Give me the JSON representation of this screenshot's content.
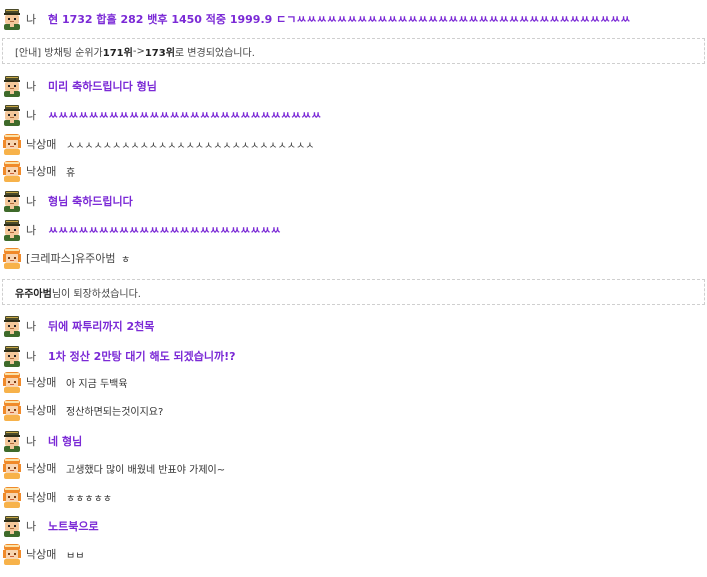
{
  "messages": [
    {
      "kind": "chat",
      "avatar": "male-soldier",
      "name": "나",
      "text": "현 1732 합홀 282 뱃후 1450 적중 1999.9 ㄷㄱㅆㅆㅆㅆㅆㅆㅆㅆㅆㅆㅆㅆㅆㅆㅆㅆㅆㅆㅆㅆㅆㅆㅆㅆㅆㅆㅆㅆㅆㅆㅆㅆㅆ"
    },
    {
      "kind": "notice",
      "parts": [
        {
          "text": "[안내] 방채팅 순위가 ",
          "bold": false
        },
        {
          "text": "171위",
          "bold": true
        },
        {
          "text": " -> ",
          "bold": false
        },
        {
          "text": "173위",
          "bold": true
        },
        {
          "text": " 로 변경되었습니다.",
          "bold": false
        }
      ]
    },
    {
      "kind": "chat",
      "avatar": "male-soldier",
      "name": "나",
      "text": "미리 축하드립니다 형님"
    },
    {
      "kind": "chat",
      "avatar": "male-soldier",
      "name": "나",
      "text": "ㅆㅆㅆㅆㅆㅆㅆㅆㅆㅆㅆㅆㅆㅆㅆㅆㅆㅆㅆㅆㅆㅆㅆㅆㅆㅆㅆ"
    },
    {
      "kind": "chat",
      "avatar": "female-orange",
      "name": "낙상매",
      "text": "ㅅㅅㅅㅅㅅㅅㅅㅅㅅㅅㅅㅅㅅㅅㅅㅅㅅㅅㅅㅅㅅㅅㅅㅅㅅㅅㅅ"
    },
    {
      "kind": "chat",
      "avatar": "female-orange",
      "name": "낙상매",
      "text": "휴"
    },
    {
      "kind": "chat",
      "avatar": "male-soldier",
      "name": "나",
      "text": "형님 축하드립니다"
    },
    {
      "kind": "chat",
      "avatar": "male-soldier",
      "name": "나",
      "text": "ㅆㅆㅆㅆㅆㅆㅆㅆㅆㅆㅆㅆㅆㅆㅆㅆㅆㅆㅆㅆㅆㅆㅆ"
    },
    {
      "kind": "chat",
      "avatar": "female-orange",
      "name": "[크레파스]유주아범",
      "text": "ㅎ"
    },
    {
      "kind": "notice",
      "parts": [
        {
          "text": "유주아범",
          "bold": true
        },
        {
          "text": "님이 퇴장하셨습니다.",
          "bold": false
        }
      ]
    },
    {
      "kind": "chat",
      "avatar": "male-soldier",
      "name": "나",
      "text": "뒤에 짜투리까지 2천목"
    },
    {
      "kind": "chat",
      "avatar": "male-soldier",
      "name": "나",
      "text": "1차 정산 2만탕 대기 해도 되겠습니까!?"
    },
    {
      "kind": "chat",
      "avatar": "female-orange",
      "name": "낙상매",
      "text": "아 지금 두백육"
    },
    {
      "kind": "chat",
      "avatar": "female-orange",
      "name": "낙상매",
      "text": "정산하면되는것이지요?"
    },
    {
      "kind": "chat",
      "avatar": "male-soldier",
      "name": "나",
      "text": "네 형님"
    },
    {
      "kind": "chat",
      "avatar": "female-orange",
      "name": "낙상매",
      "text": "고생했다 많이 배웠네 반표야 가제이~"
    },
    {
      "kind": "chat",
      "avatar": "female-orange",
      "name": "낙상매",
      "text": "ㅎㅎㅎㅎㅎ"
    },
    {
      "kind": "chat",
      "avatar": "male-soldier",
      "name": "나",
      "text": "노트북으로"
    },
    {
      "kind": "chat",
      "avatar": "female-orange",
      "name": "낙상매",
      "text": "ㅂㅂ"
    }
  ],
  "colors": {
    "my_message": "#7b2ad6",
    "other_message": "#333333",
    "notice_border": "#cfcfcf"
  }
}
